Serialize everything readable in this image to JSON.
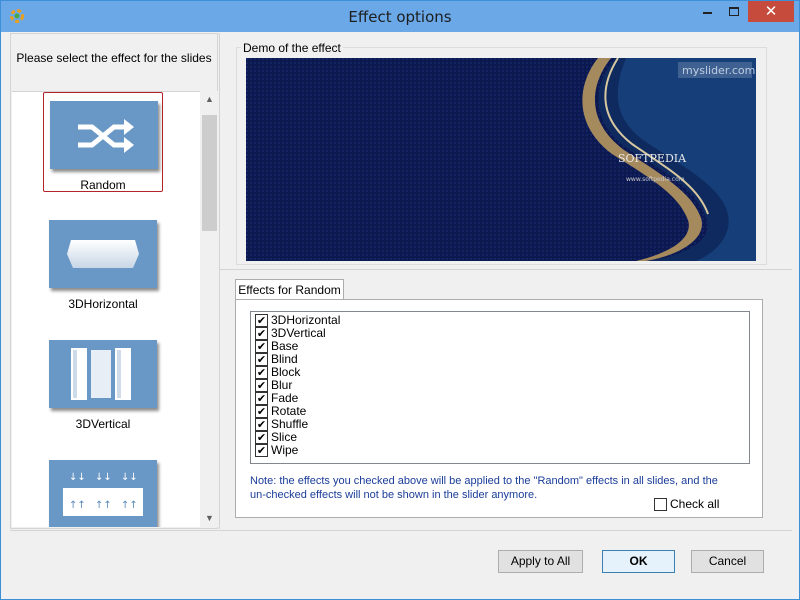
{
  "window": {
    "title": "Effect options",
    "close_glyph": "✕",
    "app_icon": "app-logo-icon"
  },
  "left": {
    "title": "Please select the effect for the slides",
    "effects": [
      {
        "label": "Random",
        "icon": "shuffle-icon",
        "selected": true
      },
      {
        "label": "3DHorizontal",
        "icon": "3d-horizontal-icon",
        "selected": false
      },
      {
        "label": "3DVertical",
        "icon": "3d-vertical-icon",
        "selected": false
      },
      {
        "label": "",
        "icon": "3d-vertical-arrows-icon",
        "selected": false
      }
    ],
    "scroll_up": "▲",
    "scroll_down": "▼"
  },
  "demo": {
    "label": "Demo of the effect",
    "watermark": "myslider.com",
    "brand": "SOFTPEDIA",
    "url": "www.softpedia.com"
  },
  "effects_tab": {
    "tab_label": "Effects for Random",
    "check_mark": "✔",
    "items": [
      {
        "label": "3DHorizontal",
        "checked": true
      },
      {
        "label": "3DVertical",
        "checked": true
      },
      {
        "label": "Base",
        "checked": true
      },
      {
        "label": "Blind",
        "checked": true
      },
      {
        "label": "Block",
        "checked": true
      },
      {
        "label": "Blur",
        "checked": true
      },
      {
        "label": "Fade",
        "checked": true
      },
      {
        "label": "Rotate",
        "checked": true
      },
      {
        "label": "Shuffle",
        "checked": true
      },
      {
        "label": "Slice",
        "checked": true
      },
      {
        "label": "Wipe",
        "checked": true
      }
    ],
    "note": "Note: the effects you checked above will be applied to the \"Random\"  effects in all slides, and the un-checked effects will not be shown in the slider anymore.",
    "check_all_label": "Check all",
    "check_all_checked": false
  },
  "buttons": {
    "apply_all": "Apply to All",
    "ok": "OK",
    "cancel": "Cancel"
  },
  "colors": {
    "titlebar": "#6aa8e8",
    "close": "#c74b3c",
    "note_text": "#1b3d9a",
    "selection_border": "#b0242a",
    "thumb_bg": "#6a98c6"
  }
}
